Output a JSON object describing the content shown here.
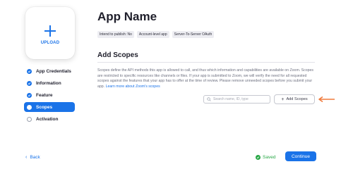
{
  "upload": {
    "label": "UPLOAD"
  },
  "nav": {
    "items": [
      {
        "label": "App Credentials"
      },
      {
        "label": "Information"
      },
      {
        "label": "Feature"
      },
      {
        "label": "Scopes"
      },
      {
        "label": "Activation"
      }
    ]
  },
  "header": {
    "title": "App Name",
    "badges": [
      "Intend to publish: No",
      "Account-level app",
      "Server-To-Server OAuth"
    ]
  },
  "scopes": {
    "title": "Add Scopes",
    "description": "Scopes define the API methods this app is allowed to call, and thus which information and capabilities are available on Zoom. Scopes are restricted to specific resources like channels or files. If your app is submitted to Zoom, we will verify the need for all requested scopes against the features that your app has to offer at the time of review. Please remove unneeded scopes before you submit your app.",
    "link": "Learn more about Zoom's scopes",
    "search_placeholder": "Search name, ID, type",
    "add_button": "Add Scopes"
  },
  "footer": {
    "back": "Back",
    "saved": "Saved",
    "continue": "Continue"
  },
  "colors": {
    "accent": "#1a73e8",
    "saved": "#27a745",
    "arrow": "#f07a3c"
  }
}
